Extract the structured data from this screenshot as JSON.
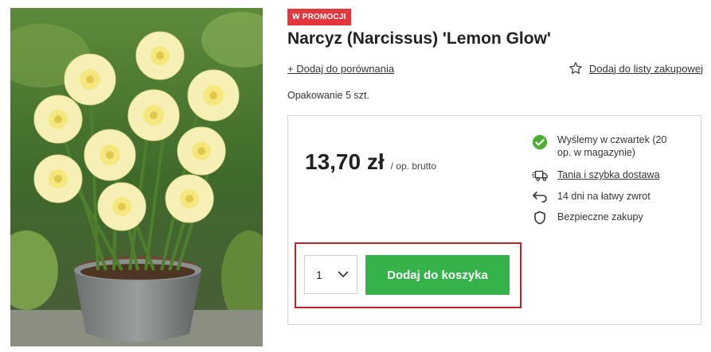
{
  "product": {
    "badge": "W PROMOCJI",
    "title": "Narcyz (Narcissus) 'Lemon Glow'",
    "compare_link": "+ Dodaj do porównania",
    "wishlist_link": "Dodaj do listy zakupowej",
    "packaging": "Opakowanie 5 szt.",
    "price": "13,70 zł",
    "price_unit": "/ op. brutto"
  },
  "info": {
    "shipping": "Wyślemy w czwartek (20 op. w magazynie)",
    "delivery": "Tania i szybka dostawa",
    "returns": "14 dni na łatwy zwrot",
    "secure": "Bezpieczne zakupy"
  },
  "cart": {
    "quantity": "1",
    "add_label": "Dodaj do koszyka"
  },
  "colors": {
    "badge": "#e2363f",
    "add_button": "#35b24a",
    "highlight": "#c0222a",
    "check": "#4caf2e"
  }
}
